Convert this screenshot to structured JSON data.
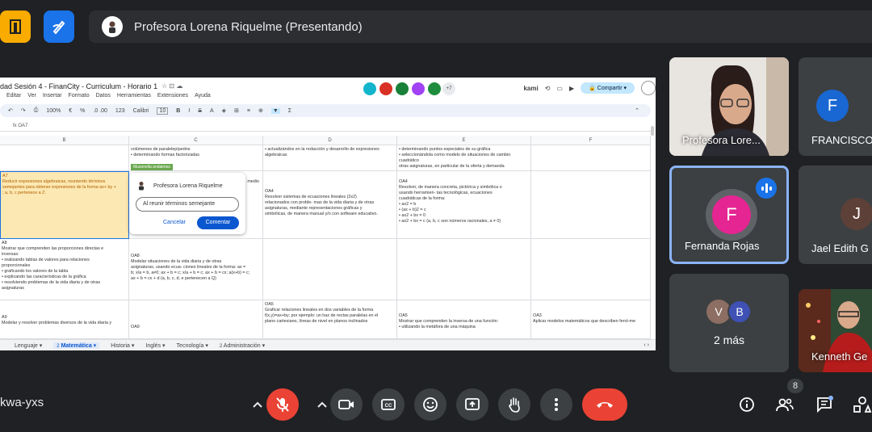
{
  "presenter": {
    "banner": "Profesora Lorena Riquelme (Presentando)"
  },
  "sheet": {
    "title": "dad Sesión 4 - FinanCity - Curriculum - Horario 1",
    "menu": [
      "Editar",
      "Ver",
      "Insertar",
      "Formato",
      "Datos",
      "Herramientas",
      "Extensiones",
      "Ayuda"
    ],
    "extra_count": "+7",
    "kami": "kami",
    "share": "Compartir",
    "toolbar": {
      "zoom": "100%",
      "currency": "€",
      "percent": "%",
      "decimals": ".0 .00",
      "format": "123",
      "font": "Calibri",
      "size": "10"
    },
    "cell_ref": "OA7",
    "columns": [
      "B",
      "C",
      "D",
      "E",
      "F"
    ],
    "tag": "Musonella andaimes",
    "cells": {
      "b_row1": "",
      "c_row1": "volúmenes de paralelepípedos\n• determinando formas factorizadas",
      "d_row1": "• actualizándos en la redacción y desarrollo de expresiones algebraicas",
      "e_row1": "• determinando puntos especiales de su gráfica\n• seleccionándola como modelo de situaciones de cambio cuadrático\notras asignaturas, en particular de la oferta y demanda",
      "b_row2": "A7\nReducir expresiones algebraicas, reuniendo términos\nsemejantes para obtener expresiones de la forma ax+ by +\n; a, b, c pertenece a Z.",
      "c_row2_tail": "medio",
      "d_row2": "OA4\nResolver sistemas de ecuaciones lineales (2x2)\nrelacionados con proble- mas de la vida diaria y de otras\nasignaturas, mediante representaciones gráficas y\nsimbólicas, de manera manual y/o con software educativo.",
      "e_row2": "OA4\nResolver, de manera concreta, pictórica y simbólica o\nusando herramien- tas tecnológicas, ecuaciones\ncuadráticas de la forma:\n• ax2 = b\n• (ax + b)2 = c\n• ax2 + bx = 0\n• ax2 + bx = c (a, b, c son números racionales, a ≠ 0)",
      "b_row3": "A8\nMostrar que comprenden las proporciones directas e\ninversas:\n• realizando tablas de valores para relaciones\nproporcionales\n• graficando los valores de la tabla\n• explicando las características de la gráfica\n• resolviendo problemas de la vida diaria y de otras\nasignaturas",
      "c_row3": "OA8\nModelar situaciones de la vida diaria y de otras\nasignaturas, usando ecua- ciones lineales de la forma: ax =\nb; x/a = b, a≠0; ax + b = c; x/a + b = c; ax + b = cx; a(x+b) = c;\nax + b = cx + d   (a, b, c, d, e pertenecen a Q)",
      "b_row4": "A9\nModelar y resolver problemas diversos de la vida diaria y",
      "c_row4": "OA9",
      "d_row4": "OA5\nGraficar relaciones lineales en dos variables de la forma\nf(x,y)=ax+by; por ejemplo: un haz de rectas paralelas en el\nplano cartesiano, líneas de nivel en planos inclinados",
      "e_row4": "OA5\nMostrar que comprenden la inversa de una función:\n• utilizando la metáfora de una máquina",
      "f_row4": "OA3\nAplicar modelos matemáticos que describen fenó-me"
    },
    "comment": {
      "author": "Profesora Lorena Riquelme",
      "input_value": "Al reunir términos semejante",
      "cancel": "Cancelar",
      "submit": "Comentar"
    },
    "tabs": [
      "Lenguaje",
      "Matemática",
      "Historia",
      "Inglés",
      "Tecnología",
      "Administración"
    ],
    "tab_numbers": [
      "2",
      "2"
    ]
  },
  "participants": {
    "t1": {
      "name": "Profesora Lore..."
    },
    "t2": {
      "name": "FRANCISCO",
      "initial": "F",
      "color": "#1967d2"
    },
    "t3": {
      "name": "Fernanda Rojas",
      "initial": "F",
      "color": "#e52592"
    },
    "t4": {
      "name": "Jael Edith G",
      "initial": "J",
      "color": "#5d4037"
    },
    "t5": {
      "label": "2 más",
      "initials": [
        "V",
        "B"
      ],
      "colors": [
        "#8d6e63",
        "#3f51b5"
      ]
    },
    "t6": {
      "name": "Kenneth Ge"
    }
  },
  "bottom": {
    "meeting_code": "kwa-yxs",
    "people_count": "8"
  },
  "colors": {
    "end_call": "#ea4335",
    "mic_off": "#ea4335",
    "accent": "#8ab4f8"
  }
}
